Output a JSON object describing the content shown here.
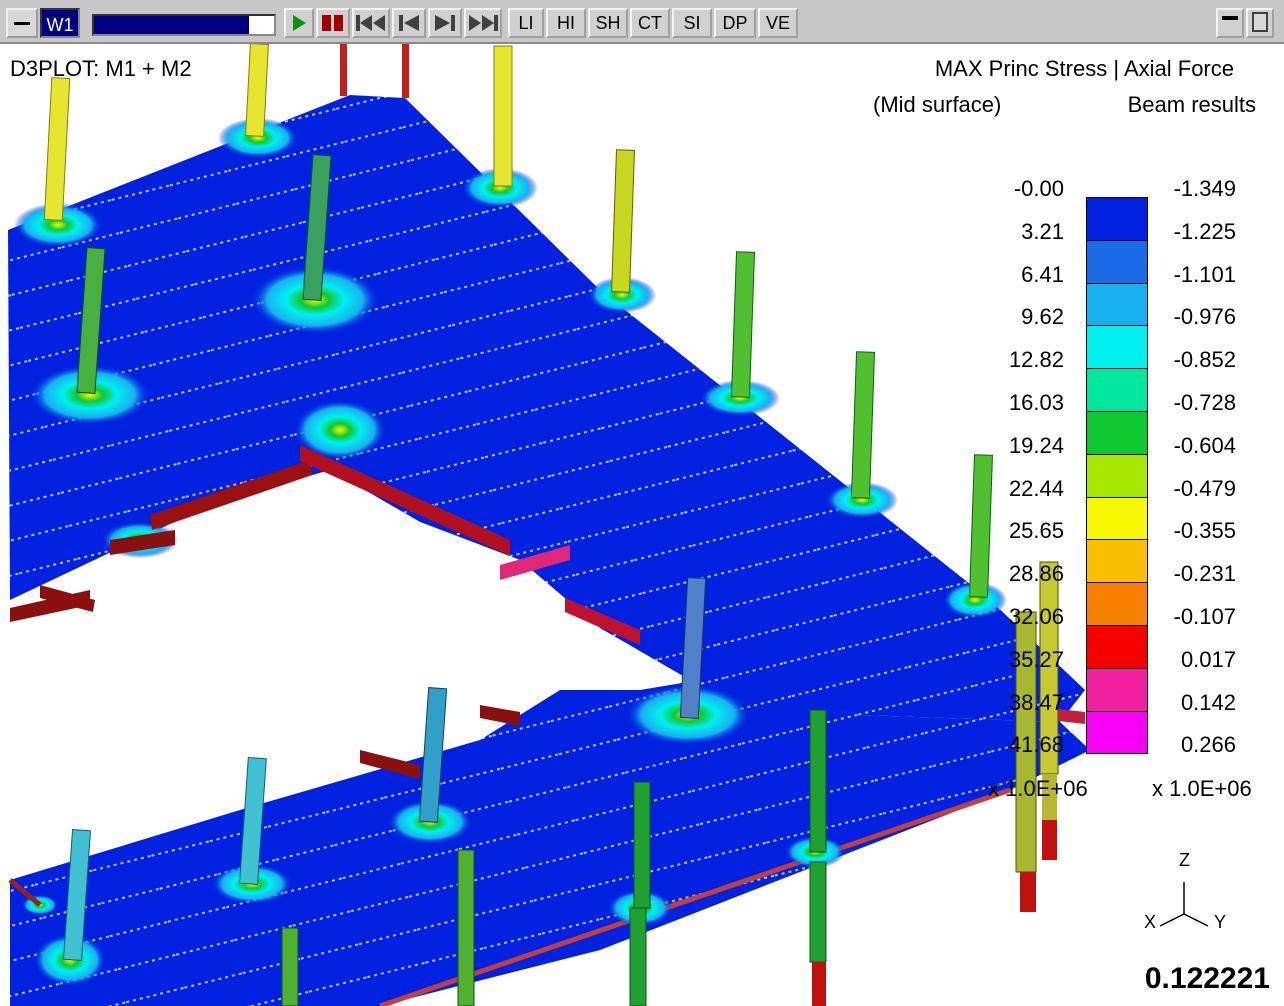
{
  "window": {
    "label": "W1",
    "progress": 0.86,
    "tabs": [
      "LI",
      "HI",
      "SH",
      "CT",
      "SI",
      "DP",
      "VE"
    ]
  },
  "plot": {
    "title": "D3PLOT: M1 + M2",
    "contour_header_left": "MAX Princ Stress | Axial Force",
    "subheader_left": "(Mid surface)",
    "subheader_right": "Beam results",
    "scale_left": "x 1.0E+06",
    "scale_right": "x 1.0E+06",
    "time": "0.122221"
  },
  "legend": {
    "left_values": [
      "-0.00",
      "3.21",
      "6.41",
      "9.62",
      "12.82",
      "16.03",
      "19.24",
      "22.44",
      "25.65",
      "28.86",
      "32.06",
      "35.27",
      "38.47",
      "41.68"
    ],
    "right_values": [
      "-1.349",
      "-1.225",
      "-1.101",
      "-0.976",
      "-0.852",
      "-0.728",
      "-0.604",
      "-0.479",
      "-0.355",
      "-0.231",
      "-0.107",
      "0.017",
      "0.142",
      "0.266"
    ],
    "colors": [
      "#0022e0",
      "#1a6ae8",
      "#19b0f0",
      "#00f0f0",
      "#00e8a0",
      "#10c830",
      "#a8e800",
      "#f8f800",
      "#f8c000",
      "#f88000",
      "#f80000",
      "#f020a0",
      "#f800f8"
    ]
  },
  "axes": {
    "z": "Z",
    "x": "X",
    "y": "Y"
  }
}
